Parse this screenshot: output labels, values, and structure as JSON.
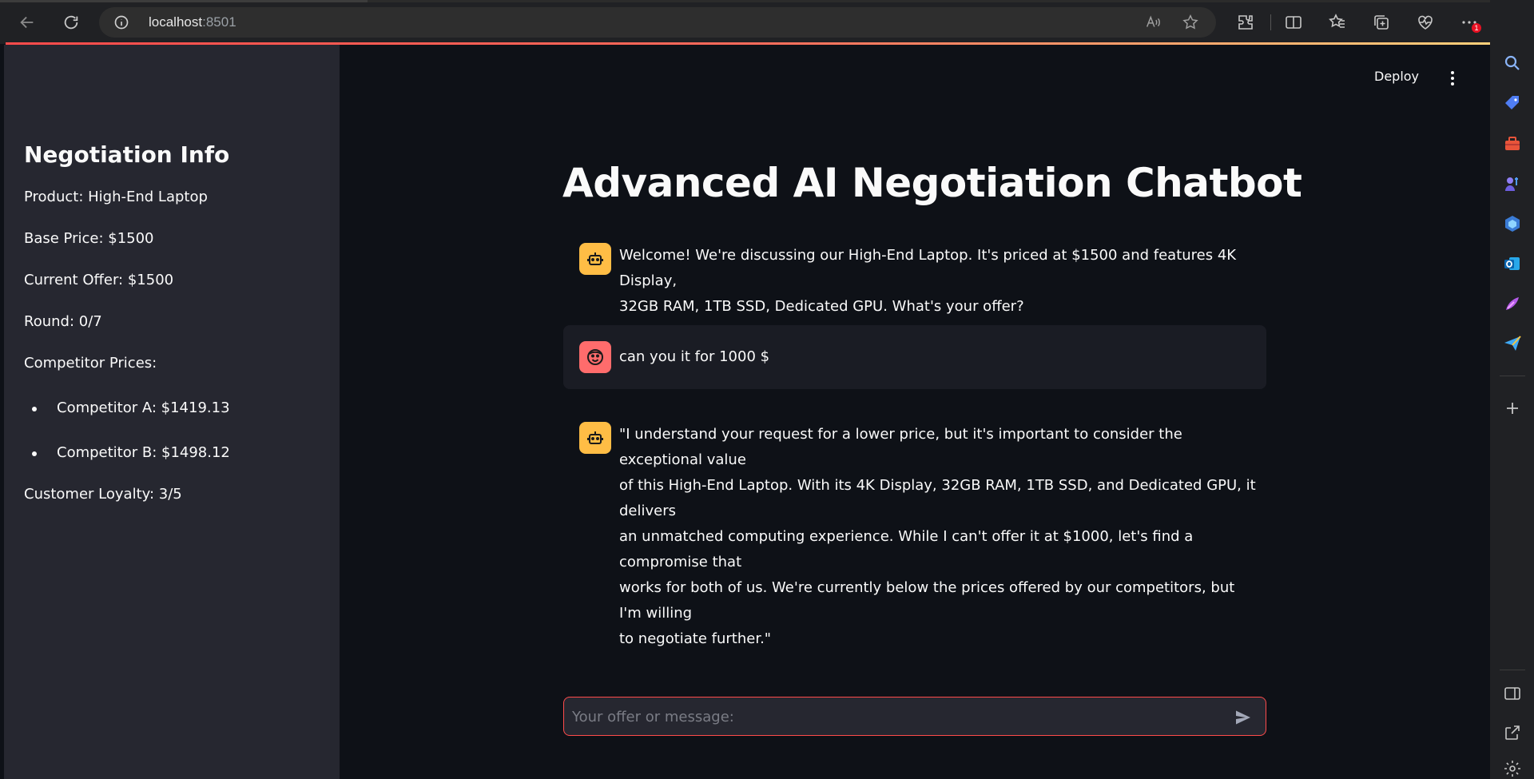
{
  "browser": {
    "url_host": "localhost",
    "url_port": ":8501",
    "notification_count": "1"
  },
  "header": {
    "deploy_label": "Deploy"
  },
  "sidebar": {
    "title": "Negotiation Info",
    "product": "Product: High-End Laptop",
    "base_price": "Base Price: $1500",
    "current_offer": "Current Offer: $1500",
    "round": "Round: 0/7",
    "competitor_heading": "Competitor Prices:",
    "competitors": [
      "Competitor A: $1419.13",
      "Competitor B: $1498.12"
    ],
    "loyalty": "Customer Loyalty: 3/5"
  },
  "main": {
    "title": "Advanced AI Negotiation Chatbot",
    "messages": [
      {
        "role": "assistant",
        "line1": "Welcome! We're discussing our High-End Laptop. It's priced at $1500 and features 4K Display,",
        "line2": "32GB RAM, 1TB SSD, Dedicated GPU. What's your offer?"
      },
      {
        "role": "user",
        "line1": "can you it for 1000 $"
      },
      {
        "role": "assistant",
        "line1": "\"I understand your request for a lower price, but it's important to consider the exceptional value",
        "line2": "of this High-End Laptop. With its 4K Display, 32GB RAM, 1TB SSD, and Dedicated GPU, it delivers",
        "line3": "an unmatched computing experience. While I can't offer it at $1000, let's find a compromise that",
        "line4": "works for both of us. We're currently below the prices offered by our competitors, but I'm willing",
        "line5": "to negotiate further.\""
      }
    ]
  },
  "chat_input": {
    "placeholder": "Your offer or message:"
  },
  "colors": {
    "accent": "#ff4b4b",
    "sidebar_bg": "#262730",
    "main_bg": "#0e1117",
    "bot_avatar": "#ffbd45",
    "user_avatar": "#ff6c6c"
  },
  "icons": [
    "back-icon",
    "refresh-icon",
    "info-icon",
    "read-aloud-icon",
    "favorite-star-icon",
    "extensions-icon",
    "split-screen-icon",
    "favorites-icon",
    "collections-icon",
    "health-icon",
    "more-icon",
    "copilot-icon",
    "send-icon",
    "robot-icon",
    "smiley-face-icon"
  ]
}
